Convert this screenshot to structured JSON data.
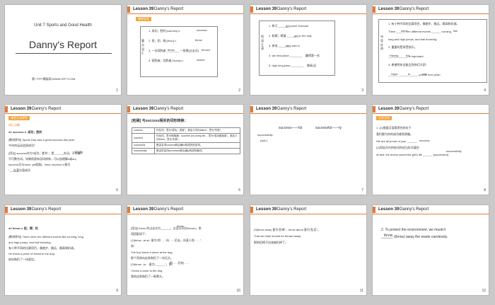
{
  "slides": [
    {
      "num": "1",
      "unit": "Unit 7  Sports and Good Health",
      "title": "Danny's Report",
      "footer": "第一PPT模板网-WWW.1PPT.COM"
    },
    {
      "num": "2",
      "lesson": "Lesson 39",
      "report": "Danny's Report",
      "tag": "课堂导学",
      "lines": [
        "1. 成功；胜利 [sək'ses]  n.",
        "2. 投；扔；抛 [θrəʊ]  v.",
        "3. 一位获胜者 ________ 一投掷(过去式)",
        "4. 获胜者；优胜者 ['wɪnə]  n."
      ],
      "answers": [
        "success",
        "throw",
        "threw",
        "thrown",
        "winner"
      ],
      "side": "重点词汇"
    },
    {
      "num": "3",
      "lesson": "Lesson 39",
      "report": "Danny's Report",
      "side": "短语互译",
      "lines": [
        "1. 练习 ________",
        "2. 妨碍；碍道 ________",
        "3. 参加 ________",
        "4. win first place ________",
        "5. high long jump ________"
      ],
      "answers": [
        "get some exercise",
        "get in the way",
        "take part in",
        "赢得第一名",
        "跳高/远"
      ]
    },
    {
      "num": "4",
      "lesson": "Lesson 39",
      "report": "Danny's Report",
      "side": "句型在线",
      "lines": [
        "1. 有十种不同的比赛项目，像跑步、跳远、跳高和扔球。",
        "There ______ ten different events ______ running,",
        "long and high jumps, and ball throwing.",
        "2. 重要的是享受快乐。",
        "______ ______ is important.",
        "3. 希望明年还能见到你们大家！",
        "______ ______ ______ you all next year!"
      ],
      "answers": [
        "were",
        "like",
        "Having",
        "fun",
        "Hope",
        "to",
        "see"
      ]
    },
    {
      "num": "5",
      "lesson": "Lesson 39",
      "report": "Danny's Report",
      "tag": "课堂互动探究",
      "sub": "词汇点睛",
      "head": "●1  success  n. 成功；胜利",
      "lines": [
        "[教材原句] Sports Day was a great success this year!",
        "今年的运动会很成功！",
        "[用法] success作为“成功；胜利”，是______名词，不可数",
        "不可数名词。如果前面有冠词修饰，可以加理解a或an。",
        "success可与have, get搭配。have success in意为",
        "“______”"
      ],
      "answers": [
        "不可数",
        "在某方面成功"
      ]
    },
    {
      "num": "6",
      "lesson": "Lesson 39",
      "report": "Danny's Report",
      "head": "[拓展] 与success相关的词形转换：",
      "rows": [
        [
          "success",
          "作名词，意为“成功；成就”，其反义词为failure，意为“失败”。"
        ],
        [
          "succeed",
          "作动词，意为明指通；succeed (in) doing sth.，意为“成功做某事”。其反义词为fail，意为“失败”。"
        ],
        [
          "successful",
          "是由名词success和后缀ful构成的形容词。"
        ],
        [
          "successfully",
          "是由形容词successful和后缀ly构成的副词。"
        ]
      ]
    },
    {
      "num": "7",
      "lesson": "Lesson 39",
      "report": "Danny's Report",
      "lines": [
        "success——ful",
        "successful——ly",
        "successfully",
        "(adv.)"
      ]
    },
    {
      "num": "8",
      "lesson": "Lesson 39",
      "report": "Danny's Report",
      "tag": "活学活用",
      "lines": [
        "1. (1)根据汉语意思完成句子",
        "我们都为你的成功感到骄傲。",
        "We are all proud of your ______.",
        "(2)用括号内所给词的适当形式填空",
        "At last, the doctor saved the girl's life ______ (successful)."
      ],
      "answers": [
        "success",
        "successfully"
      ]
    },
    {
      "num": "9",
      "lesson": "Lesson 39",
      "report": "Danny's Report",
      "head": "●2  throw  v. 投；掷；扔",
      "lines": [
        "[教材原句] There were ten different events like running, long",
        "and high jumps, and ball throwing.",
        "有十种不同的比赛项目，像跑步、跳远、跳高和扔球。",
        "He threw a piece of bread to the dog.",
        "他向狗扔了一块面包。"
      ]
    },
    {
      "num": "10",
      "lesson": "Lesson 39",
      "report": "Danny's Report",
      "lines": [
        "[用法] throw 的过去式为______，过去分词为thrown。常",
        "用搭配如下：",
        "(1)throw...at sb. 意为“把……向……扔去，向某人投……”",
        "如：",
        "The boy threw a stone at the dog.",
        "那个男孩向这条狗扔了一块石头。",
        "(2)throw...to... 意为“______”。如：",
        "I threw a bone to the dog.",
        "我给这条狗扔了一根骨头。"
      ],
      "answers": [
        "threw",
        "把……扔给……"
      ]
    },
    {
      "num": "11",
      "lesson": "Lesson 39",
      "report": "Danny's Report",
      "lines": [
        "(3)throw away 意为“扔掉”，throw about 意为“乱丢”。",
        "That old chair should be thrown away.",
        "那把旧椅子应该被扔掉了。"
      ]
    },
    {
      "num": "12",
      "lesson": "Lesson 39",
      "report": "Danny's Report",
      "lines": [
        "2. To protect the environment, we mustn't",
        "______ (throw) away the waste carelessly."
      ],
      "answers": [
        "throw"
      ]
    }
  ]
}
